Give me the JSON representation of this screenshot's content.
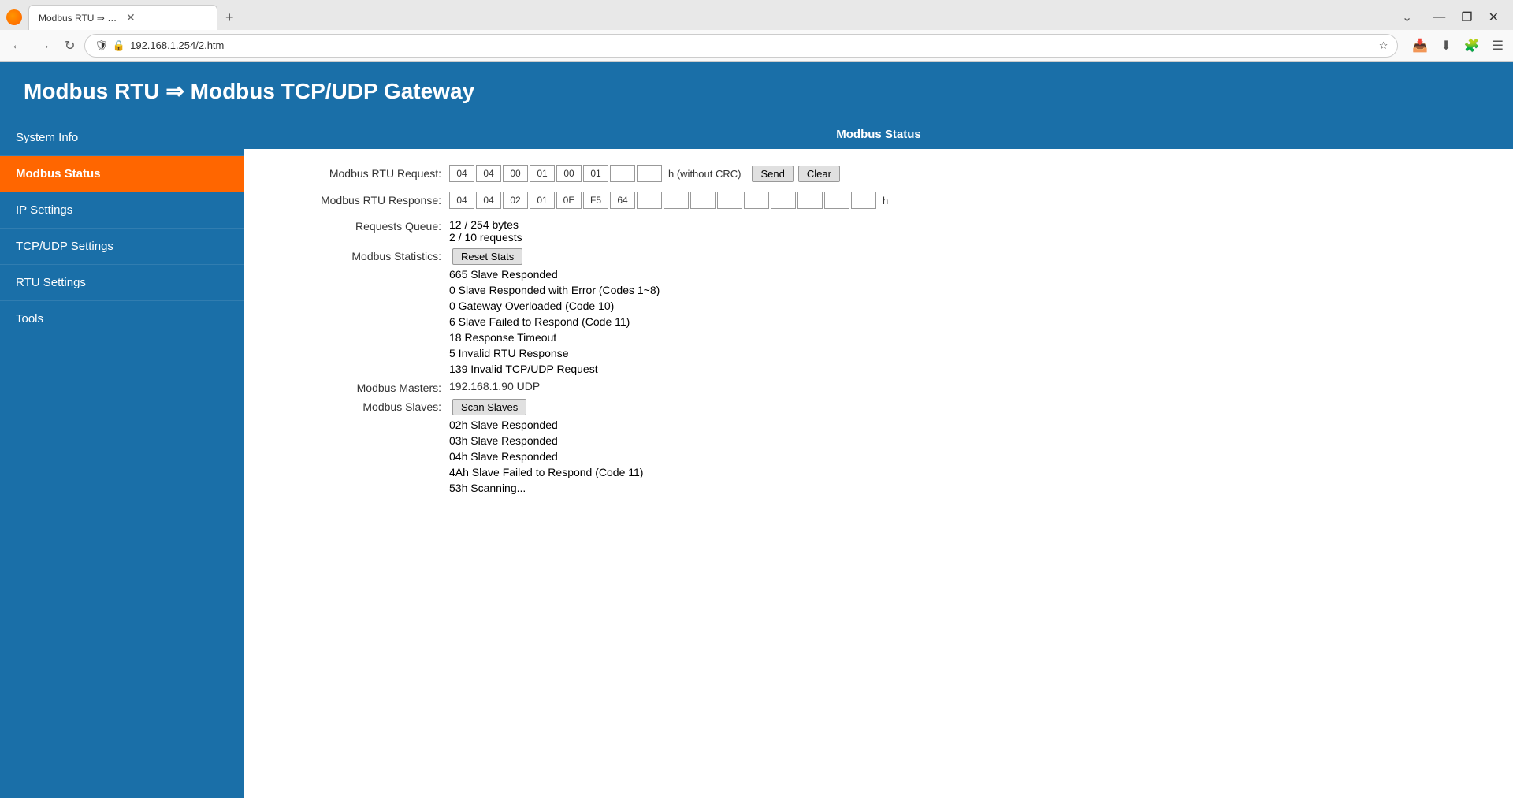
{
  "browser": {
    "tab_title": "Modbus RTU ⇒ Modbus TCP/UDP G",
    "url": "192.168.1.254/2.htm",
    "new_tab_label": "+",
    "back_btn": "←",
    "forward_btn": "→",
    "reload_btn": "↻"
  },
  "page": {
    "title": "Modbus RTU ⇒ Modbus TCP/UDP Gateway"
  },
  "sidebar": {
    "items": [
      {
        "id": "system-info",
        "label": "System Info",
        "active": false
      },
      {
        "id": "modbus-status",
        "label": "Modbus Status",
        "active": true
      },
      {
        "id": "ip-settings",
        "label": "IP Settings",
        "active": false
      },
      {
        "id": "tcp-udp-settings",
        "label": "TCP/UDP Settings",
        "active": false
      },
      {
        "id": "rtu-settings",
        "label": "RTU Settings",
        "active": false
      },
      {
        "id": "tools",
        "label": "Tools",
        "active": false
      }
    ]
  },
  "content": {
    "header": "Modbus Status",
    "rtu_request": {
      "label": "Modbus RTU Request:",
      "bytes": [
        "04",
        "04",
        "00",
        "01",
        "00",
        "01",
        "",
        ""
      ],
      "suffix": "h (without CRC)",
      "send_btn": "Send",
      "clear_btn": "Clear"
    },
    "rtu_response": {
      "label": "Modbus RTU Response:",
      "bytes": [
        "04",
        "04",
        "02",
        "01",
        "0E",
        "F5",
        "64",
        "",
        "",
        "",
        "",
        "",
        "",
        "",
        "",
        ""
      ],
      "suffix": "h"
    },
    "requests_queue": {
      "label": "Requests Queue:",
      "line1": "12 / 254 bytes",
      "line2": "2 / 10 requests"
    },
    "modbus_statistics": {
      "label": "Modbus Statistics:",
      "reset_btn": "Reset Stats",
      "stats": [
        "665 Slave Responded",
        "0 Slave Responded with Error (Codes 1~8)",
        "0 Gateway Overloaded (Code 10)",
        "6 Slave Failed to Respond (Code 11)",
        "18 Response Timeout",
        "5 Invalid RTU Response",
        "139 Invalid TCP/UDP Request"
      ]
    },
    "modbus_masters": {
      "label": "Modbus Masters:",
      "value": "192.168.1.90 UDP"
    },
    "modbus_slaves": {
      "label": "Modbus Slaves:",
      "scan_btn": "Scan Slaves",
      "slaves": [
        "02h Slave Responded",
        "03h Slave Responded",
        "04h Slave Responded",
        "4Ah Slave Failed to Respond (Code 11)",
        "53h Scanning..."
      ]
    }
  }
}
